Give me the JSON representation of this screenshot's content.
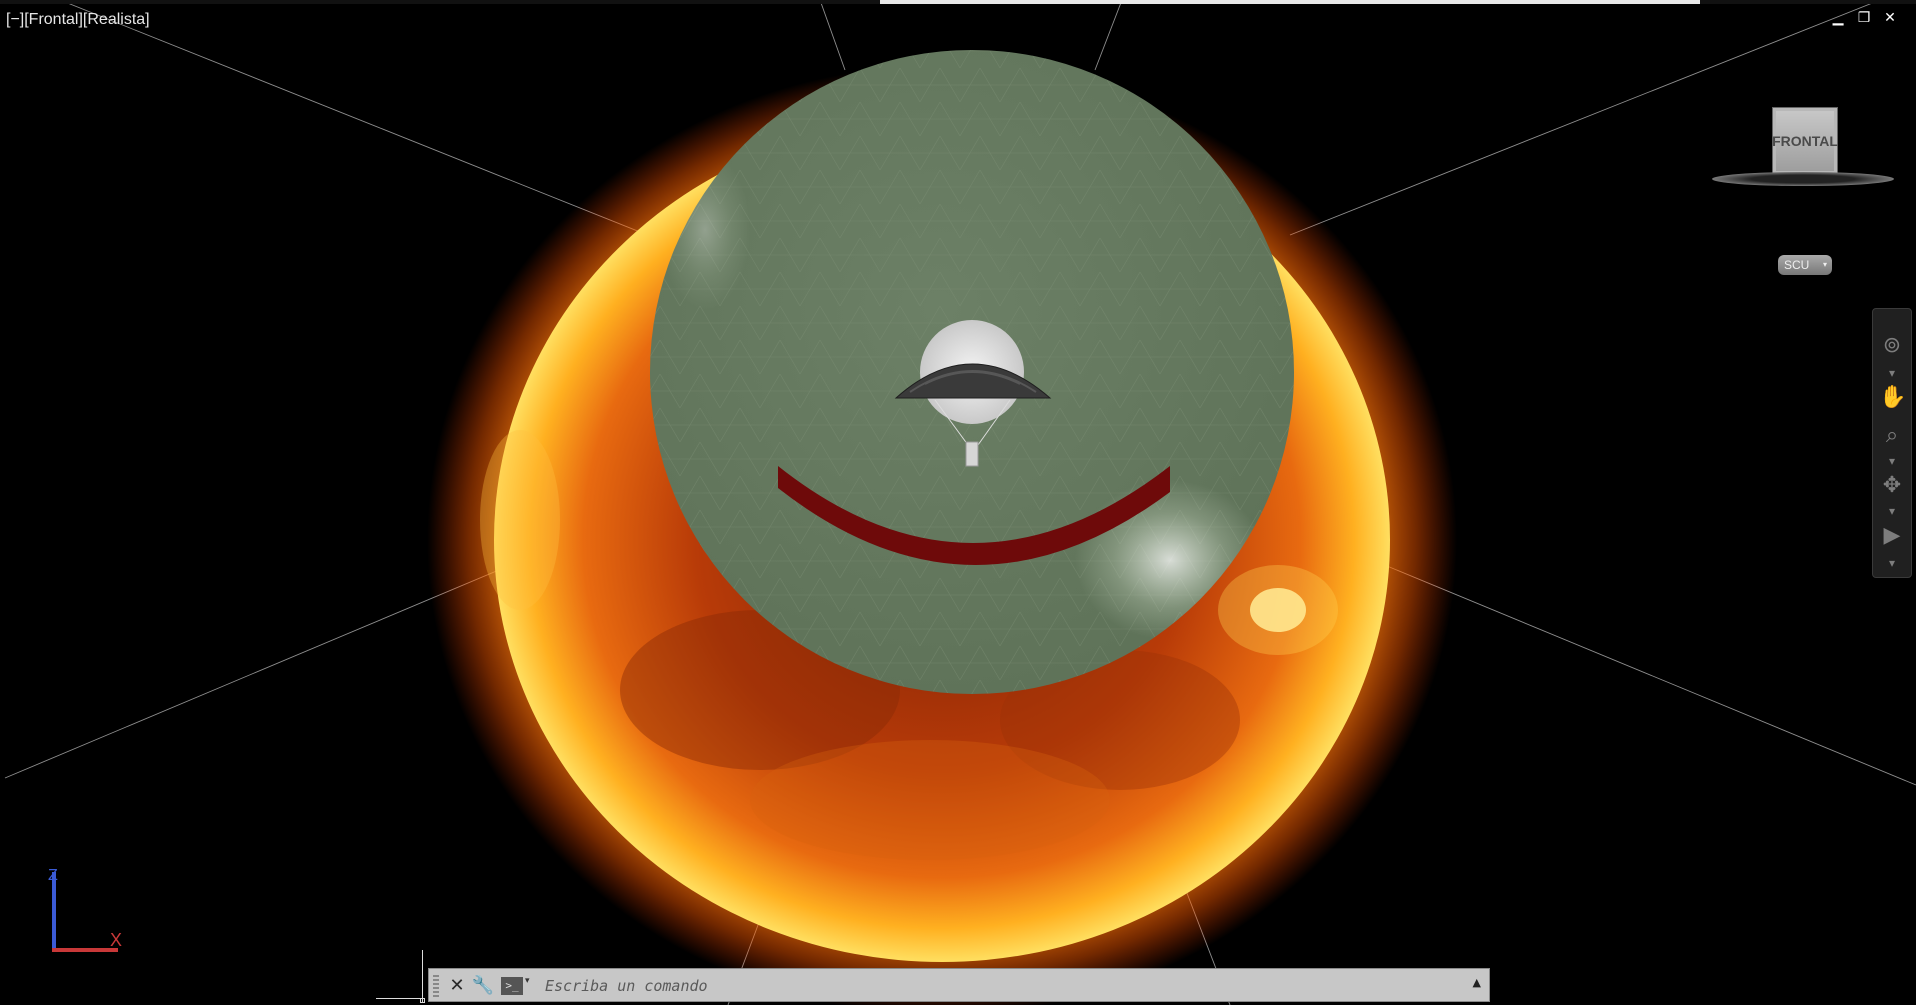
{
  "viewport": {
    "label": "[−][Frontal][Realista]"
  },
  "window_controls": {
    "minimize": "▁",
    "restore": "❐",
    "close": "✕"
  },
  "viewcube": {
    "face_label": "FRONTAL"
  },
  "ucs_menu": {
    "label": "SCU",
    "arrow": "▾"
  },
  "navigation_bar": {
    "tools": [
      "full-navigation-wheel",
      "pan",
      "zoom",
      "orbit",
      "showmotion"
    ]
  },
  "ucs_axes": {
    "z_label": "Z",
    "x_label": "X"
  },
  "command_line": {
    "close_glyph": "✕",
    "customize_glyph": "🔧",
    "prompt_glyph": ">_",
    "prompt_arrow": "▾",
    "placeholder": "Escriba un comando",
    "expand_glyph": "▲"
  },
  "colors": {
    "background": "#000000",
    "sphere": "#65795f",
    "sun_core": "#c0480c",
    "sun_glow": "#ffb01e",
    "smile": "#6e0a0a",
    "command_bar": "#c7c7c7"
  }
}
